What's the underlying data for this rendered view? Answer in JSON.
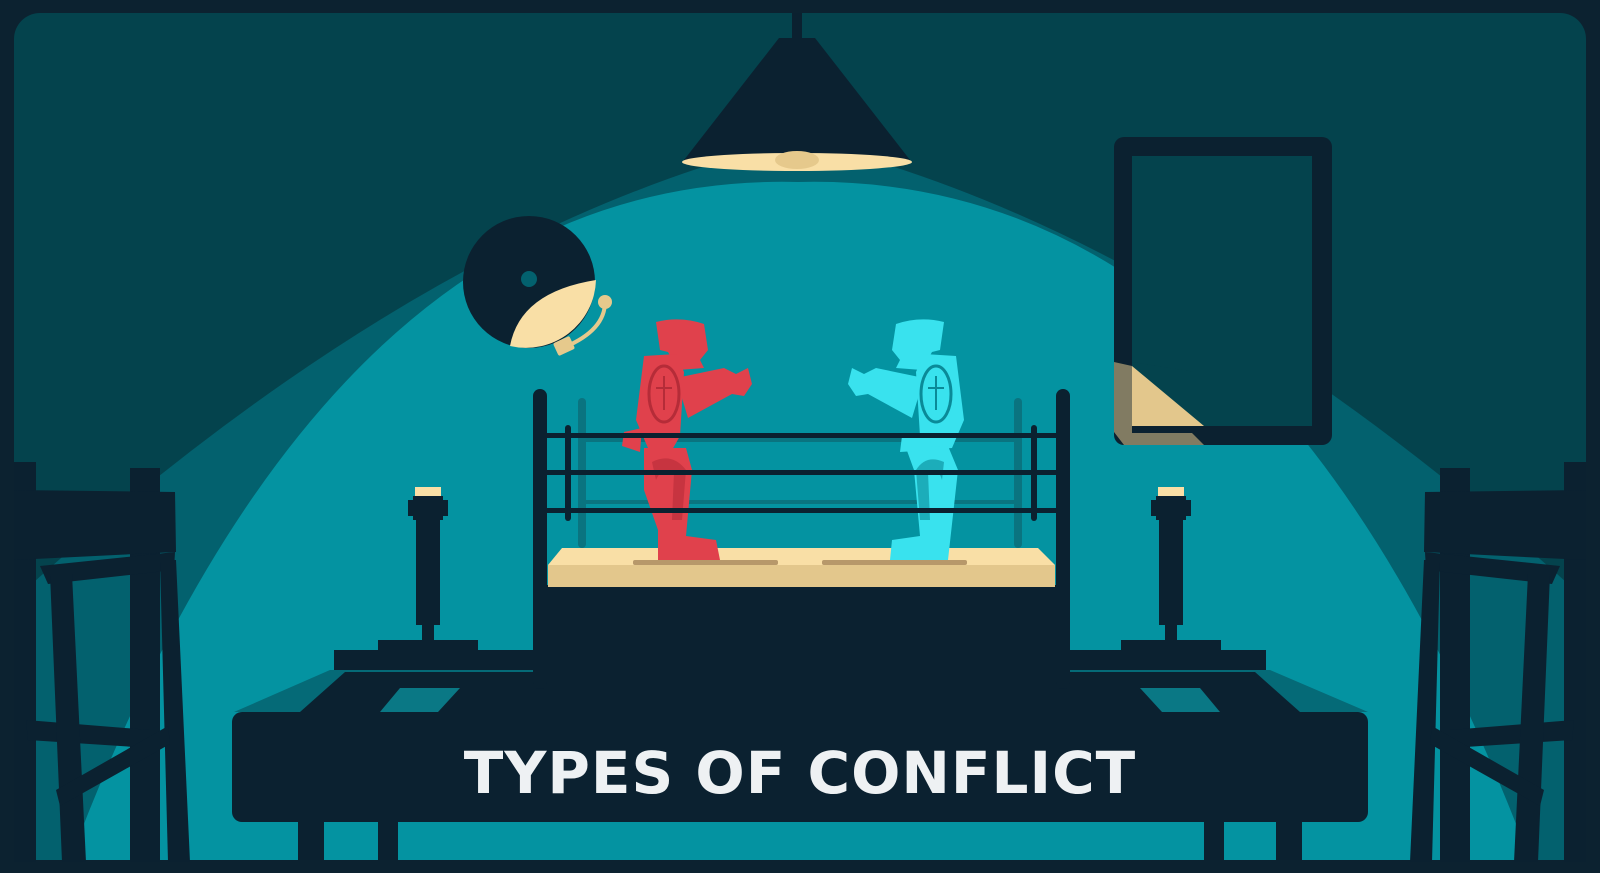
{
  "banner": {
    "title": "TYPES OF CONFLICT"
  },
  "palette": {
    "frame": "#0c2230",
    "wall_dark": "#04434d",
    "wall_mid": "#03616e",
    "spotlight": "#0493a1",
    "navy": "#0b2130",
    "cream": "#f9dfa6",
    "mat": "#e3c78c",
    "red_robot": "#e0414c",
    "cyan_robot": "#39e2ee",
    "title_text": "#eef1f3"
  },
  "icons": {
    "lamp": "pendant-lamp-icon",
    "bell": "boxing-bell-icon",
    "red_fighter": "red-robot-boxer-icon",
    "blue_fighter": "cyan-robot-boxer-icon",
    "ring": "boxing-ring-icon",
    "picture_frame": "wall-frame-icon",
    "left_joystick": "joystick-icon",
    "right_joystick": "joystick-icon",
    "left_chair": "chair-icon",
    "right_chair": "chair-icon"
  }
}
